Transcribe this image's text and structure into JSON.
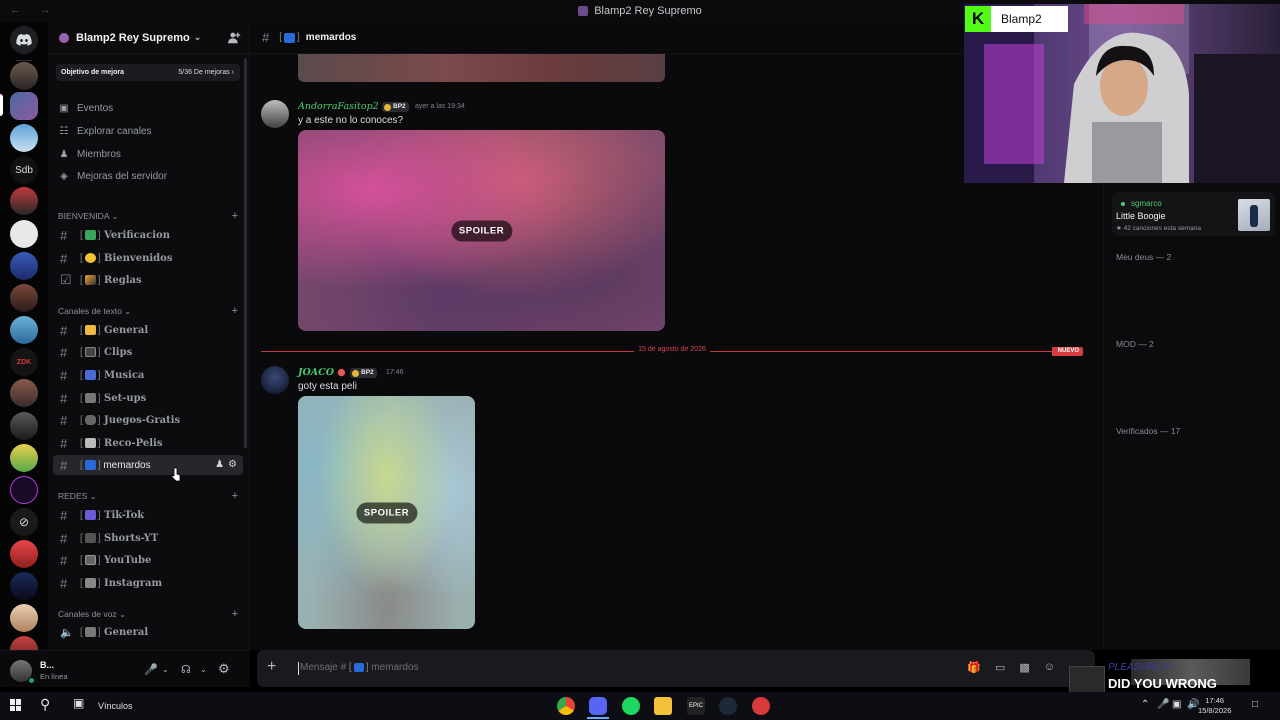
{
  "window": {
    "title": "Blamp2 Rey Supremo"
  },
  "server": {
    "name": "Blamp2 Rey Supremo",
    "boost_goal_label": "Objetivo de mejora",
    "boost_progress": "5/36 De mejoras",
    "nav": [
      {
        "label": "Eventos",
        "icon": "calendar-icon"
      },
      {
        "label": "Explorar canales",
        "icon": "channels-browse-icon"
      },
      {
        "label": "Miembros",
        "icon": "members-icon"
      },
      {
        "label": "Mejoras del servidor",
        "icon": "boost-icon"
      }
    ]
  },
  "categories": {
    "bienvenida": "BIENVENIDA",
    "texto": "Canales de texto",
    "redes": "REDES",
    "voz": "Canales de voz"
  },
  "channels": {
    "bienvenida": [
      {
        "label": "Verificacion",
        "icon": "check-emoji"
      },
      {
        "label": "Bienvenidos",
        "icon": "smile-emoji"
      },
      {
        "label": "Reglas",
        "icon": "pencil-emoji"
      }
    ],
    "texto": [
      {
        "label": "General",
        "icon": "hand-emoji"
      },
      {
        "label": "Clips",
        "icon": "film-emoji"
      },
      {
        "label": "Musica",
        "icon": "music-emoji"
      },
      {
        "label": "Set-ups",
        "icon": "laptop-emoji"
      },
      {
        "label": "Juegos-Gratis",
        "icon": "gamepad-emoji"
      },
      {
        "label": "Reco-Pelis",
        "icon": "popcorn-emoji"
      },
      {
        "label": "memardos",
        "icon": "wheelchair-emoji"
      }
    ],
    "redes": [
      {
        "label": "Tik-Tok",
        "icon": "music-emoji"
      },
      {
        "label": "Shorts-YT",
        "icon": "clapper-emoji"
      },
      {
        "label": "YouTube",
        "icon": "tv-emoji"
      },
      {
        "label": "Instagram",
        "icon": "camera-emoji"
      }
    ],
    "voz": [
      {
        "label": "General",
        "icon": "speaker-emoji"
      }
    ]
  },
  "user": {
    "name": "B...",
    "status": "En línea"
  },
  "chat": {
    "channel": "memardos",
    "messages": [
      {
        "author": "AndorraFasitop2",
        "tag": "BP2",
        "time": "ayer a las 19:34",
        "text": "y a este no lo conoces?",
        "spoiler_label": "SPOILER"
      },
      {
        "author": "JOACO",
        "tag": "BP2",
        "time": "17:46",
        "text": "goty esta peli",
        "spoiler_label": "SPOILER"
      }
    ],
    "separator_date": "15 de agosto de 2026",
    "new_badge": "NUEVO",
    "composer_placeholder": "Mensaje #",
    "composer_channel": "memardos"
  },
  "members": {
    "now_playing": {
      "user": "sgmarco",
      "song": "Little Boogie",
      "count": "42 canciones esta semana"
    },
    "groups": [
      "Meu deus — 2",
      "MOD — 2",
      "Verificados — 17"
    ]
  },
  "stream": {
    "platform_name": "Blamp2",
    "music_title": "PLEASURE P",
    "music_song": "DID YOU WRONG"
  },
  "taskbar": {
    "pinned_label": "Vínculos",
    "time": "17:46",
    "date": "15/8/2026"
  },
  "colors": {
    "online": "#23a55a",
    "username_green": "#4ecb71",
    "new_marker": "#d83c3e",
    "kick_green": "#53fc18"
  }
}
